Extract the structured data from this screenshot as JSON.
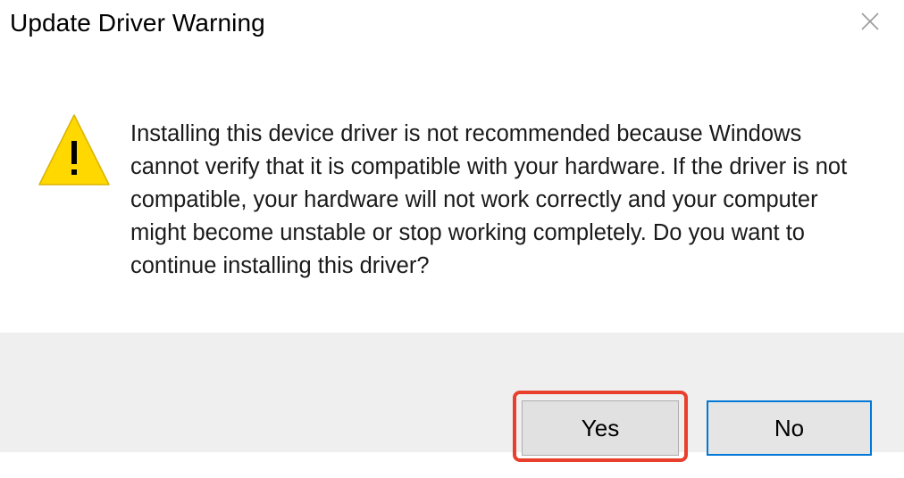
{
  "dialog": {
    "title": "Update Driver Warning",
    "close_icon": "close-icon",
    "warning_icon": "warning-icon",
    "message": "Installing this device driver is not recommended because Windows\ncannot verify that it is compatible with your hardware.  If the driver is not\ncompatible, your hardware will not work correctly and your computer\nmight become unstable or stop working completely.  Do you want to\ncontinue installing this driver?",
    "buttons": {
      "yes_label": "Yes",
      "no_label": "No"
    }
  },
  "colors": {
    "footer_bg": "#efefef",
    "focus_border": "#0078d7",
    "highlight": "#e8402c",
    "warning_fill": "#ffd800"
  }
}
